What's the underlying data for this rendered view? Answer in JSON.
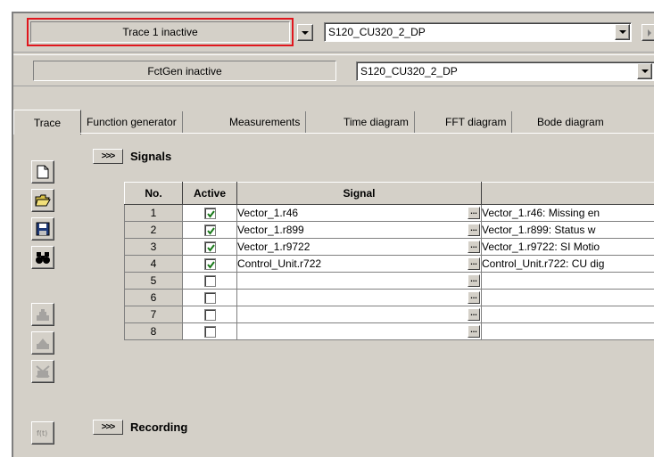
{
  "trace_bar": {
    "status": "Trace 1 inactive",
    "device": "S120_CU320_2_DP"
  },
  "fctgen_bar": {
    "status": "FctGen inactive",
    "device": "S120_CU320_2_DP"
  },
  "tabs": [
    {
      "label": "Trace"
    },
    {
      "label": "Function generator"
    },
    {
      "label": "Measurements"
    },
    {
      "label": "Time diagram"
    },
    {
      "label": "FFT diagram"
    },
    {
      "label": "Bode diagram"
    }
  ],
  "toolbar": [
    {
      "icon": "new-document-icon"
    },
    {
      "icon": "open-folder-icon"
    },
    {
      "icon": "save-disk-icon"
    },
    {
      "icon": "binoculars-icon"
    },
    {
      "icon": "upload-icon"
    },
    {
      "icon": "download-icon"
    },
    {
      "icon": "delete-icon"
    },
    {
      "icon": "function-icon"
    }
  ],
  "signals_section": {
    "expander": ">>>",
    "title": "Signals",
    "headers": {
      "no": "No.",
      "active": "Active",
      "signal": "Signal",
      "description": ""
    },
    "rows": [
      {
        "no": "1",
        "active": true,
        "signal": "Vector_1.r46",
        "description": "Vector_1.r46: Missing en"
      },
      {
        "no": "2",
        "active": true,
        "signal": "Vector_1.r899",
        "description": "Vector_1.r899: Status w"
      },
      {
        "no": "3",
        "active": true,
        "signal": "Vector_1.r9722",
        "description": "Vector_1.r9722: SI Motio"
      },
      {
        "no": "4",
        "active": true,
        "signal": "Control_Unit.r722",
        "description": "Control_Unit.r722: CU dig"
      },
      {
        "no": "5",
        "active": false,
        "signal": "",
        "description": ""
      },
      {
        "no": "6",
        "active": false,
        "signal": "",
        "description": ""
      },
      {
        "no": "7",
        "active": false,
        "signal": "",
        "description": ""
      },
      {
        "no": "8",
        "active": false,
        "signal": "",
        "description": ""
      }
    ],
    "ellipsis": "..."
  },
  "recording_section": {
    "expander": ">>>",
    "title": "Recording"
  },
  "colors": {
    "highlight": "#e0161d",
    "panel": "#d4d0c8",
    "checkmark": "#1a7a1a"
  }
}
